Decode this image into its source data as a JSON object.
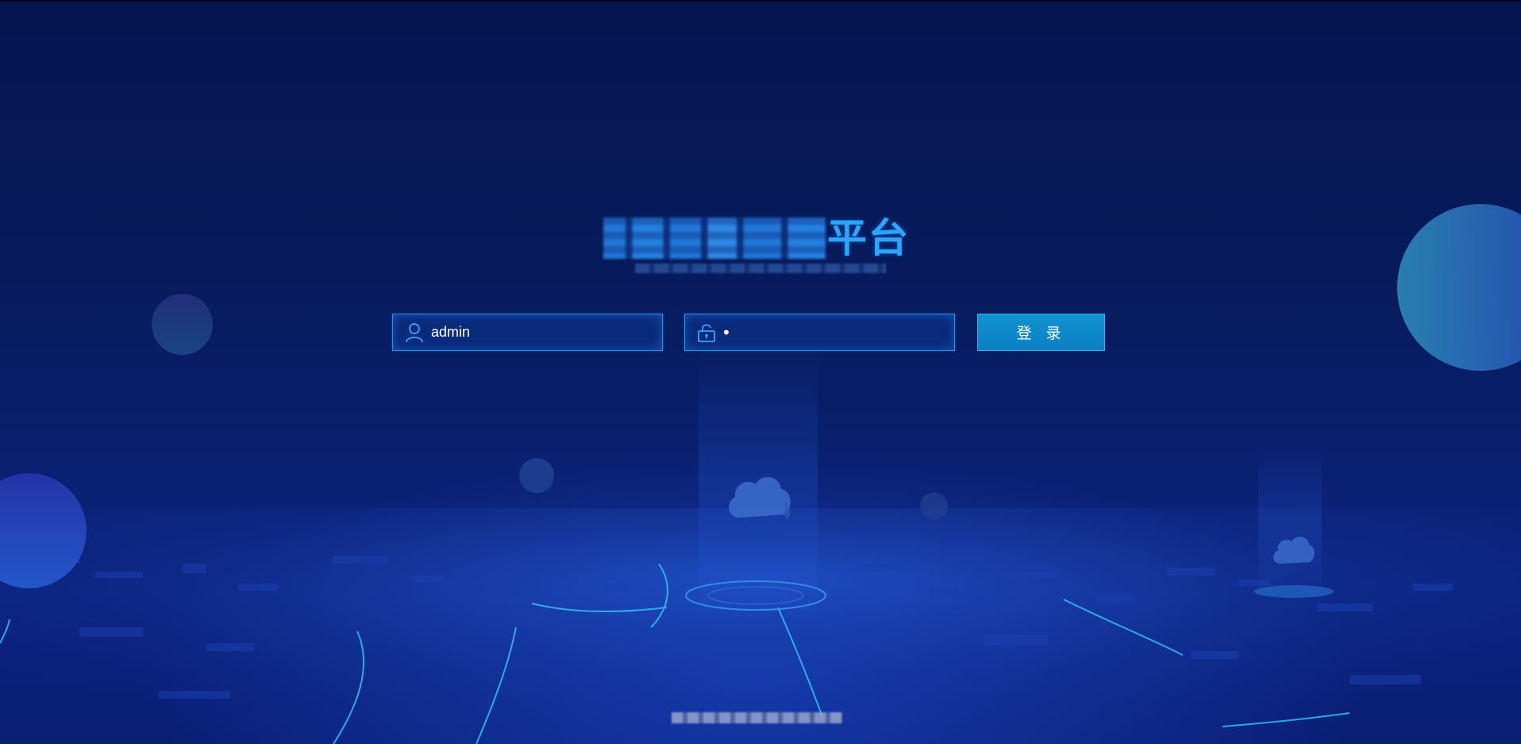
{
  "header": {
    "title_visible": "平台"
  },
  "login": {
    "username": {
      "value": "admin",
      "icon": "user-icon"
    },
    "password": {
      "value": "•",
      "icon": "unlock-icon"
    },
    "submit_label": "登 录"
  },
  "colors": {
    "accent": "#2ba6ff",
    "button": "#0a88c8",
    "background": "#071a5a"
  }
}
